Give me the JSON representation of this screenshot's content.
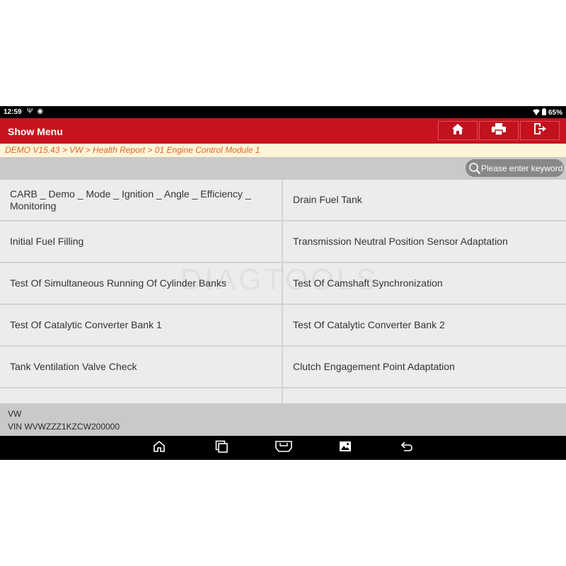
{
  "status_bar": {
    "time": "12:59",
    "battery": "65%"
  },
  "header": {
    "title": "Show Menu"
  },
  "toolbar": {
    "home_icon": "home-icon",
    "print_icon": "print-icon",
    "exit_icon": "exit-icon"
  },
  "breadcrumb": {
    "text": "DEMO V15.43 > VW > Health Report > 01 Engine Control Module 1"
  },
  "search": {
    "placeholder": "Please enter keyword"
  },
  "menu": {
    "items": [
      "CARB _ Demo _ Mode _ Ignition _ Angle _ Efficiency _ Monitoring",
      "Drain Fuel Tank",
      "Initial Fuel Filling",
      "Transmission Neutral Position Sensor Adaptation",
      "Test Of Simultaneous Running Of Cylinder Banks",
      "Test Of Camshaft Synchronization",
      "Test Of Catalytic Converter Bank 1",
      "Test Of Catalytic Converter Bank 2",
      "Tank Ventilation Valve Check",
      "Clutch Engagement Point Adaptation",
      "",
      ""
    ]
  },
  "footer": {
    "make": "VW",
    "vin": "VIN WVWZZZ1KZCW200000"
  },
  "watermark": "DIAGTOOLS",
  "colors": {
    "header": "#c8131f",
    "breadcrumb_text": "#e0662a",
    "breadcrumb_bg": "#fdf5d8"
  }
}
